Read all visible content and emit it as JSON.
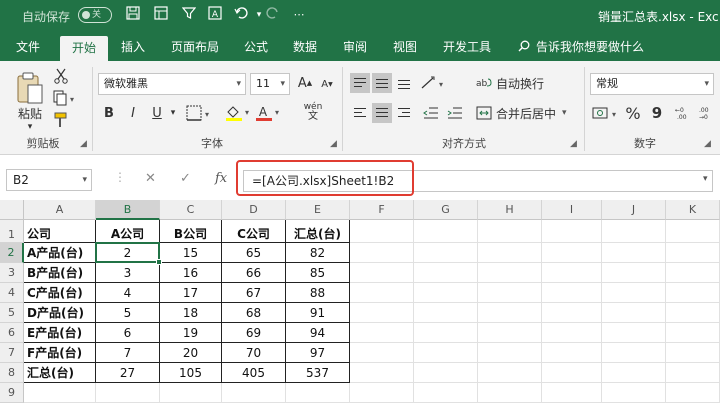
{
  "titlebar": {
    "autosave_label": "自动保存",
    "autosave_state": "关",
    "filename": "销量汇总表.xlsx - Exc"
  },
  "menu": {
    "tabs": [
      "文件",
      "开始",
      "插入",
      "页面布局",
      "公式",
      "数据",
      "审阅",
      "视图",
      "开发工具"
    ],
    "active_tab": "开始",
    "tell_me": "告诉我你想要做什么"
  },
  "ribbon": {
    "clipboard": {
      "paste": "粘贴",
      "label": "剪贴板"
    },
    "font": {
      "name": "微软雅黑",
      "size": "11",
      "label": "字体",
      "bold": "B",
      "italic": "I",
      "underline": "U",
      "grow": "A",
      "shrink": "A",
      "phonetic": "wén"
    },
    "alignment": {
      "wrap": "自动换行",
      "merge": "合并后居中",
      "label": "对齐方式"
    },
    "number": {
      "format": "常规",
      "label": "数字",
      "percent": "%",
      "comma": "9"
    }
  },
  "formula_bar": {
    "name_box": "B2",
    "fx": "fx",
    "formula": "=[A公司.xlsx]Sheet1!B2"
  },
  "sheet": {
    "columns": [
      "A",
      "B",
      "C",
      "D",
      "E",
      "F",
      "G",
      "H",
      "I",
      "J",
      "K"
    ],
    "rows": [
      "1",
      "2",
      "3",
      "4",
      "5",
      "6",
      "7",
      "8",
      "9"
    ],
    "selected_cell": "B2",
    "header": [
      "公司",
      "A公司",
      "B公司",
      "C公司",
      "汇总(台)"
    ],
    "data": [
      [
        "A产品(台)",
        "2",
        "15",
        "65",
        "82"
      ],
      [
        "B产品(台)",
        "3",
        "16",
        "66",
        "85"
      ],
      [
        "C产品(台)",
        "4",
        "17",
        "67",
        "88"
      ],
      [
        "D产品(台)",
        "5",
        "18",
        "68",
        "91"
      ],
      [
        "E产品(台)",
        "6",
        "19",
        "69",
        "94"
      ],
      [
        "F产品(台)",
        "7",
        "20",
        "70",
        "97"
      ],
      [
        "汇总(台)",
        "27",
        "105",
        "405",
        "537"
      ]
    ]
  },
  "colors": {
    "excel_green": "#217346",
    "highlight_red": "#e03c31"
  }
}
